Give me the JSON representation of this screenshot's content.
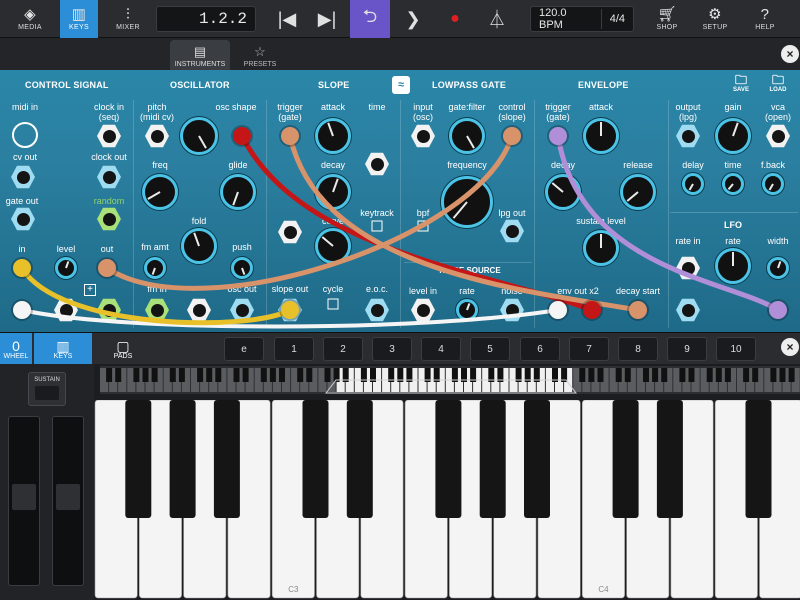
{
  "toolbar": {
    "buttons": [
      {
        "id": "media",
        "label": "MEDIA",
        "icon": "media-icon",
        "active": false
      },
      {
        "id": "keys",
        "label": "KEYS",
        "icon": "keys-icon",
        "active": true
      },
      {
        "id": "mixer",
        "label": "MIXER",
        "icon": "mixer-icon",
        "active": false
      }
    ],
    "position": "1.2.2",
    "tempo": "120.0 BPM",
    "time_signature": "4/4",
    "right_buttons": [
      {
        "id": "shop",
        "label": "SHOP",
        "icon": "cart-icon"
      },
      {
        "id": "setup",
        "label": "SETUP",
        "icon": "gear-icon"
      },
      {
        "id": "help",
        "label": "HELP",
        "icon": "question-icon"
      }
    ],
    "accent_color": "#2b8ed6",
    "loop_color": "#6a55c8",
    "record_color": "#e02020"
  },
  "browser": {
    "tabs": [
      {
        "label": "INSTRUMENTS",
        "icon": "instruments-icon",
        "active": true
      },
      {
        "label": "PRESETS",
        "icon": "star-icon",
        "active": false
      }
    ]
  },
  "panel": {
    "sections": [
      "CONTROL SIGNAL",
      "OSCILLATOR",
      "SLOPE",
      "LOWPASS GATE",
      "ENVELOPE"
    ],
    "save_label": "SAVE",
    "load_label": "LOAD",
    "labels": {
      "midi_in": "midi in",
      "clock_in": "clock in",
      "clock_in_sub": "(seq)",
      "cv_out": "cv out",
      "clock_out": "clock out",
      "gate_out": "gate out",
      "random": "random",
      "in": "in",
      "level": "level",
      "out": "out",
      "pitch": "pitch",
      "pitch_sub": "(midi cv)",
      "osc_shape": "osc shape",
      "freq": "freq",
      "glide": "glide",
      "fold": "fold",
      "fm_amt": "fm amt",
      "push": "push",
      "fm_in": "fm in",
      "osc_out": "osc out",
      "trigger": "trigger",
      "trigger_sub": "(gate)",
      "attack": "attack",
      "time": "time",
      "decay": "decay",
      "curve": "curve",
      "keytrack": "keytrack",
      "slope_out": "slope out",
      "cycle": "cycle",
      "eoc": "e.o.c.",
      "input": "input",
      "input_sub": "(osc)",
      "gate_filter": "gate:filter",
      "control": "control",
      "control_sub": "(slope)",
      "frequency": "frequency",
      "bpf": "bpf",
      "lpg_out": "lpg out",
      "noise_source": "NOISE SOURCE",
      "level_in": "level in",
      "rate": "rate",
      "noise": "noise",
      "env_attack": "attack",
      "env_decay": "decay",
      "release": "release",
      "sustain_level": "sustain level",
      "env_out": "env out x2",
      "decay_start": "decay start",
      "output": "output",
      "output_sub": "(lpg)",
      "gain": "gain",
      "vca": "vca",
      "vca_sub": "(open)",
      "delay": "delay",
      "d_time": "time",
      "fback": "f.back",
      "lfo": "LFO",
      "rate_in": "rate in",
      "lfo_rate": "rate",
      "width": "width"
    },
    "cable_colors": {
      "red": "#c41616",
      "tan": "#d9936a",
      "purple": "#b08fd8",
      "yellow": "#e8c12a",
      "white": "#f5f5f5"
    }
  },
  "keyboard": {
    "wheel_label": "WHEEL",
    "wheel_glyph": "0",
    "keys_label": "KEYS",
    "pads_label": "PADS",
    "presets": [
      "e",
      "1",
      "2",
      "3",
      "4",
      "5",
      "6",
      "7",
      "8",
      "9",
      "10"
    ],
    "sustain_label": "SUSTAIN",
    "octave_labels": [
      "C3",
      "C4"
    ]
  }
}
